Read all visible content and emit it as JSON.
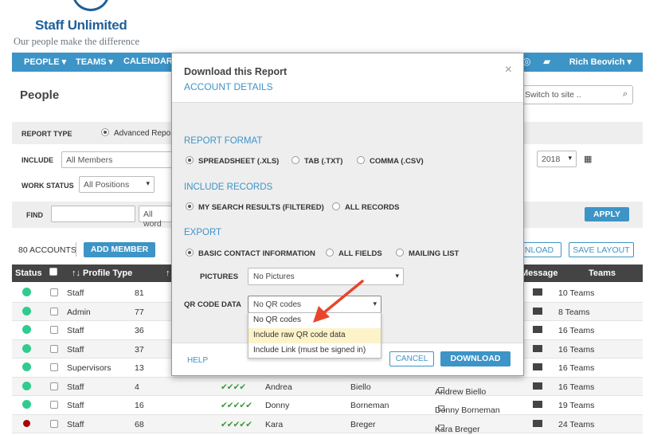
{
  "brand": {
    "name": "Staff Unlimited",
    "tagline": "Our people make the difference",
    "color": "#1f5f99"
  },
  "nav": {
    "items": [
      "PEOPLE ▾",
      "TEAMS ▾",
      "CALENDAR"
    ],
    "user": "Rich Beovich ▾",
    "accent": "#3d94c6"
  },
  "page": {
    "title": "People",
    "switch_placeholder": "Switch to site .."
  },
  "filters": {
    "report_type_label": "REPORT TYPE",
    "report_type_value": "Advanced Repo",
    "include_label": "INCLUDE",
    "include_value": "All Members",
    "year_value": "2018",
    "work_status_label": "WORK STATUS",
    "work_status_value": "All Positions",
    "find_label": "FIND",
    "find_value": "",
    "find_mode": "All word",
    "apply_label": "APPLY"
  },
  "toolbar": {
    "accounts": "80 ACCOUNTS",
    "add_member": "ADD MEMBER",
    "download": "NLOAD",
    "save_layout": "SAVE LAYOUT"
  },
  "table": {
    "headers": {
      "status": "Status",
      "profile_type": "↑↓ Profile Type",
      "sort": "↑",
      "message": "Message",
      "teams": "Teams"
    },
    "rows": [
      {
        "status": "active",
        "type": "Staff",
        "num": "81",
        "stars": "",
        "first": "",
        "last": "",
        "full": "",
        "teams": "10 Teams"
      },
      {
        "status": "active",
        "type": "Admin",
        "num": "77",
        "stars": "",
        "first": "",
        "last": "",
        "full": "",
        "teams": "8 Teams"
      },
      {
        "status": "active",
        "type": "Staff",
        "num": "36",
        "stars": "",
        "first": "",
        "last": "",
        "full": "",
        "teams": "16 Teams"
      },
      {
        "status": "active",
        "type": "Staff",
        "num": "37",
        "stars": "",
        "first": "",
        "last": "",
        "full": "",
        "teams": "16 Teams"
      },
      {
        "status": "active",
        "type": "Supervisors",
        "num": "13",
        "stars": "",
        "first": "",
        "last": "",
        "full": "",
        "teams": "16 Teams"
      },
      {
        "status": "active",
        "type": "Staff",
        "num": "4",
        "stars": "✔✔✔✔",
        "first": "Andrea",
        "last": "Biello",
        "full": "Andrew Biello",
        "teams": "16 Teams"
      },
      {
        "status": "active",
        "type": "Staff",
        "num": "16",
        "stars": "✔✔✔✔✔",
        "first": "Donny",
        "last": "Borneman",
        "full": "Donny Borneman",
        "teams": "19 Teams"
      },
      {
        "status": "inactive",
        "type": "Staff",
        "num": "68",
        "stars": "✔✔✔✔✔",
        "first": "Kara",
        "last": "Breger",
        "full": "Kara Breger",
        "teams": "24 Teams"
      }
    ]
  },
  "modal": {
    "title": "Download this Report",
    "subtitle": "ACCOUNT DETAILS",
    "report_format": {
      "heading": "REPORT FORMAT",
      "options": [
        "SPREADSHEET (.XLS)",
        "TAB (.TXT)",
        "COMMA (.CSV)"
      ],
      "selected": 0
    },
    "include_records": {
      "heading": "INCLUDE RECORDS",
      "options": [
        "MY SEARCH RESULTS (FILTERED)",
        "ALL RECORDS"
      ],
      "selected": 0
    },
    "export": {
      "heading": "EXPORT",
      "options": [
        "BASIC CONTACT INFORMATION",
        "ALL FIELDS",
        "MAILING LIST"
      ],
      "selected": 0
    },
    "pictures": {
      "label": "PICTURES",
      "value": "No Pictures"
    },
    "qr_code": {
      "label": "QR CODE DATA",
      "value": "No QR codes",
      "options": [
        "No QR codes",
        "Include raw QR code data",
        "Include Link (must be signed in)"
      ],
      "highlighted": 1
    },
    "help": "HELP",
    "cancel": "CANCEL",
    "download": "DOWNLOAD",
    "close_icon": "×"
  },
  "annotation": {
    "arrow_color": "#e8452c"
  }
}
